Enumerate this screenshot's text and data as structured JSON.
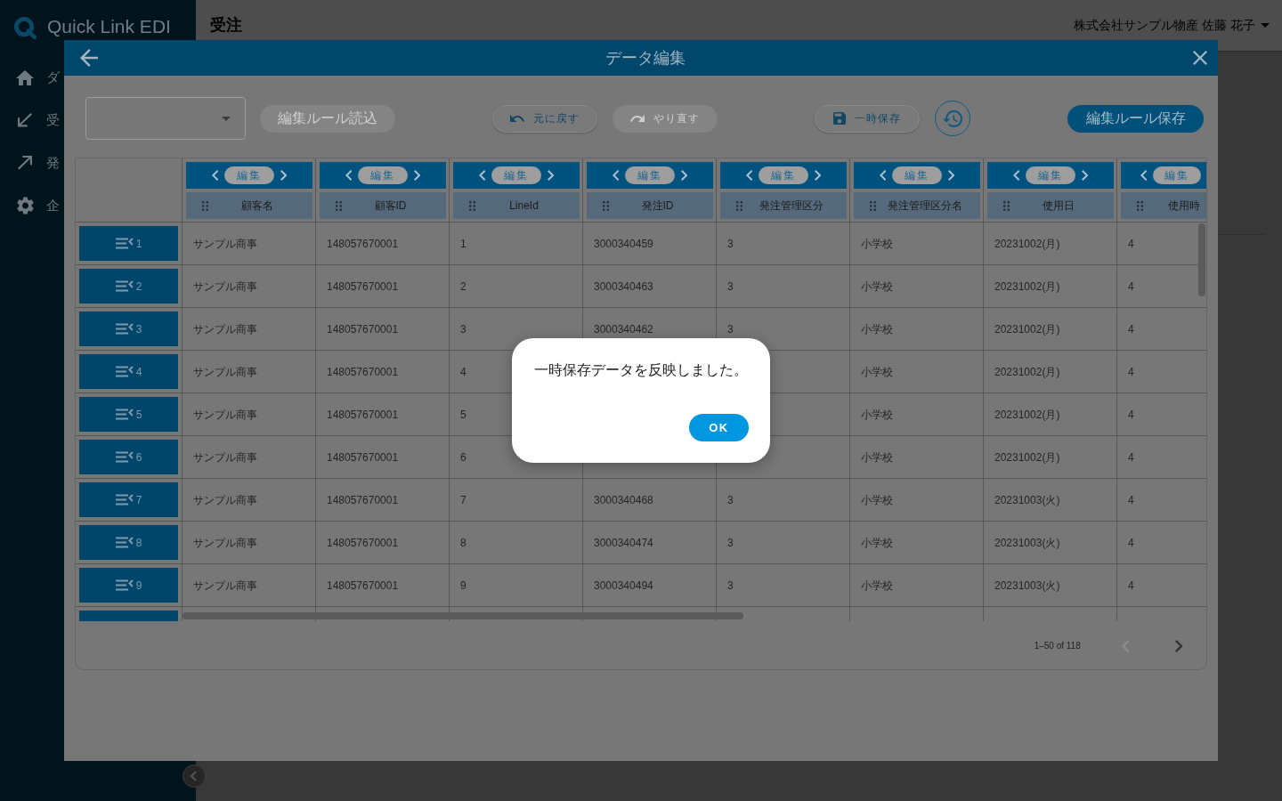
{
  "sidebar": {
    "logo_text": "Quick Link EDI",
    "items": [
      {
        "label": "ダ"
      },
      {
        "label": "受"
      },
      {
        "label": "発"
      },
      {
        "label": "企"
      }
    ]
  },
  "header": {
    "title": "受注",
    "user": "株式会社サンプル物産 佐藤 花子"
  },
  "editor": {
    "title": "データ編集",
    "toolbar": {
      "load_rule_button": {
        "label": "編集ルール読込",
        "disabled": true
      },
      "undo_button": {
        "label": "元に戻す",
        "disabled": false
      },
      "redo_button": {
        "label": "やり直す",
        "disabled": true
      },
      "temp_save_button": {
        "label": "一時保存",
        "disabled": false
      },
      "save_rule_button": {
        "label": "編集ルール保存",
        "disabled": false
      }
    },
    "table": {
      "columns": [
        {
          "edit_label": "編集",
          "label": "顧客名",
          "partly_visible": false
        },
        {
          "edit_label": "編集",
          "label": "顧客ID",
          "partly_visible": false
        },
        {
          "edit_label": "編集",
          "label": "LineId",
          "partly_visible": false
        },
        {
          "edit_label": "編集",
          "label": "発注ID",
          "partly_visible": false
        },
        {
          "edit_label": "編集",
          "label": "発注管理区分",
          "partly_visible": false
        },
        {
          "edit_label": "編集",
          "label": "発注管理区分名",
          "partly_visible": false
        },
        {
          "edit_label": "編集",
          "label": "使用日",
          "partly_visible": false
        },
        {
          "edit_label": "編集",
          "label": "使用時",
          "partly_visible": true
        }
      ],
      "rows": [
        {
          "number": "1",
          "customer_name": "サンプル商事",
          "customer_id": "148057670001",
          "line_id": "1",
          "order_id": "3000340459",
          "order_class": "3",
          "order_class_name": "小学校",
          "use_date": "20231002(月)",
          "use_time": "4"
        },
        {
          "number": "2",
          "customer_name": "サンプル商事",
          "customer_id": "148057670001",
          "line_id": "2",
          "order_id": "3000340463",
          "order_class": "3",
          "order_class_name": "小学校",
          "use_date": "20231002(月)",
          "use_time": "4"
        },
        {
          "number": "3",
          "customer_name": "サンプル商事",
          "customer_id": "148057670001",
          "line_id": "3",
          "order_id": "3000340462",
          "order_class": "3",
          "order_class_name": "小学校",
          "use_date": "20231002(月)",
          "use_time": "4"
        },
        {
          "number": "4",
          "customer_name": "サンプル商事",
          "customer_id": "148057670001",
          "line_id": "4",
          "order_class_name": "小学校",
          "use_date": "20231002(月)",
          "use_time": "4"
        },
        {
          "number": "5",
          "customer_name": "サンプル商事",
          "customer_id": "148057670001",
          "line_id": "5",
          "order_class_name": "小学校",
          "use_date": "20231002(月)",
          "use_time": "4"
        },
        {
          "number": "6",
          "customer_name": "サンプル商事",
          "customer_id": "148057670001",
          "line_id": "6",
          "order_class_name": "小学校",
          "use_date": "20231002(月)",
          "use_time": "4"
        },
        {
          "number": "7",
          "customer_name": "サンプル商事",
          "customer_id": "148057670001",
          "line_id": "7",
          "order_id": "3000340468",
          "order_class": "3",
          "order_class_name": "小学校",
          "use_date": "20231003(火)",
          "use_time": "4"
        },
        {
          "number": "8",
          "customer_name": "サンプル商事",
          "customer_id": "148057670001",
          "line_id": "8",
          "order_id": "3000340474",
          "order_class": "3",
          "order_class_name": "小学校",
          "use_date": "20231003(火)",
          "use_time": "4"
        },
        {
          "number": "9",
          "customer_name": "サンプル商事",
          "customer_id": "148057670001",
          "line_id": "9",
          "order_id": "3000340494",
          "order_class": "3",
          "order_class_name": "小学校",
          "use_date": "20231003(火)",
          "use_time": "4"
        }
      ],
      "more_rows_below": true
    },
    "pagination": {
      "range": "1–50 of 118",
      "prev_disabled": true,
      "next_disabled": false
    }
  },
  "alert": {
    "message": "一時保存データを反映しました。",
    "ok_label": "OK"
  }
}
